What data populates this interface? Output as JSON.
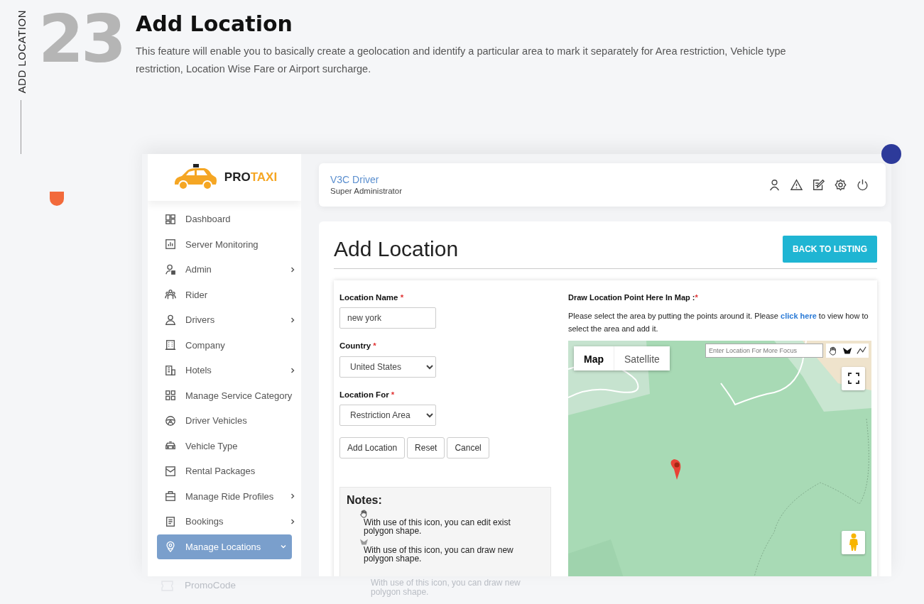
{
  "page": {
    "rail_label": "ADD LOCATION",
    "number": "23",
    "title": "Add Location",
    "description": "This feature will enable you to basically create a geolocation and identify a particular area to mark it separately for Area restriction, Vehicle type restriction, Location Wise Fare or Airport surcharge."
  },
  "app": {
    "logo": {
      "text_dark": "PRO",
      "text_accent": "TAXI"
    },
    "sidebar": {
      "items": [
        {
          "label": "Dashboard",
          "has_submenu": false,
          "expanded": false,
          "selected": false
        },
        {
          "label": "Server Monitoring",
          "has_submenu": false,
          "expanded": false,
          "selected": false
        },
        {
          "label": "Admin",
          "has_submenu": true,
          "expanded": false,
          "selected": false
        },
        {
          "label": "Rider",
          "has_submenu": false,
          "expanded": false,
          "selected": false
        },
        {
          "label": "Drivers",
          "has_submenu": true,
          "expanded": false,
          "selected": false
        },
        {
          "label": "Company",
          "has_submenu": false,
          "expanded": false,
          "selected": false
        },
        {
          "label": "Hotels",
          "has_submenu": true,
          "expanded": false,
          "selected": false
        },
        {
          "label": "Manage Service Category",
          "has_submenu": false,
          "expanded": false,
          "selected": false
        },
        {
          "label": "Driver Vehicles",
          "has_submenu": false,
          "expanded": false,
          "selected": false
        },
        {
          "label": "Vehicle Type",
          "has_submenu": false,
          "expanded": false,
          "selected": false
        },
        {
          "label": "Rental Packages",
          "has_submenu": false,
          "expanded": false,
          "selected": false
        },
        {
          "label": "Manage Ride Profiles",
          "has_submenu": true,
          "expanded": false,
          "selected": false
        },
        {
          "label": "Bookings",
          "has_submenu": true,
          "expanded": false,
          "selected": false
        },
        {
          "label": "Manage Locations",
          "has_submenu": true,
          "expanded": true,
          "selected": true
        }
      ],
      "faded_item": "PromoCode"
    },
    "header": {
      "user_name": "V3C Driver",
      "role": "Super Administrator"
    },
    "content": {
      "title": "Add Location",
      "back_button": "BACK TO LISTING",
      "form": {
        "fields": [
          {
            "kind": "text",
            "label": "Location Name",
            "required_mark": "*",
            "value": "new york"
          },
          {
            "kind": "select",
            "label": "Country",
            "required_mark": "*",
            "value": "United States"
          },
          {
            "kind": "select",
            "label": "Location For",
            "required_mark": "*",
            "value": "Restriction Area"
          }
        ],
        "buttons": [
          "Add Location",
          "Reset",
          "Cancel"
        ]
      },
      "notes": {
        "title": "Notes:",
        "items": [
          {
            "text": "With use of this icon, you can edit exist polygon shape."
          },
          {
            "text": "With use of this icon, you can draw new polygon shape."
          }
        ],
        "faded_item": "With use of this icon, you can draw new polygon shape."
      },
      "map_section": {
        "label": "Draw Location Point Here In Map :",
        "required_mark": "*",
        "instructions_before": "Please select the area by putting the points around it. Please ",
        "link": "click here",
        "instructions_after": " to view how to select the area and add it.",
        "map": {
          "kind": "picture",
          "map_types": [
            {
              "label": "Map",
              "selected": true
            },
            {
              "label": "Satellite",
              "selected": false
            }
          ],
          "search": {
            "placeholder": "Enter Location For More Focus"
          }
        }
      }
    }
  }
}
